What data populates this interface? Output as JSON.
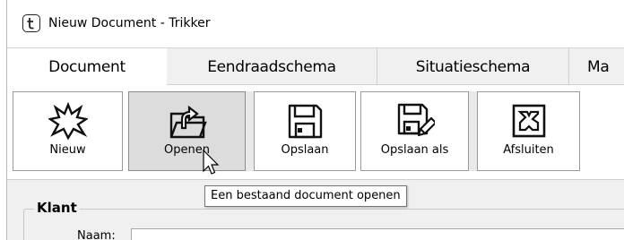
{
  "window": {
    "title": "Nieuw Document - Trikker",
    "icon": "trikker-app-icon"
  },
  "tabs": [
    {
      "label": "Document",
      "active": true
    },
    {
      "label": "Eendraadschema",
      "active": false
    },
    {
      "label": "Situatieschema",
      "active": false
    },
    {
      "label": "Ma",
      "active": false
    }
  ],
  "toolbar": {
    "buttons": [
      {
        "label": "Nieuw",
        "icon": "new-burst-icon"
      },
      {
        "label": "Openen",
        "icon": "open-folder-icon",
        "hovered": true
      },
      {
        "label": "Opslaan",
        "icon": "floppy-disk-icon"
      },
      {
        "label": "Opslaan als",
        "icon": "save-as-floppy-icon"
      },
      {
        "label": "Afsluiten",
        "icon": "close-x-icon"
      }
    ]
  },
  "tooltip": {
    "text": "Een bestaand document openen"
  },
  "form": {
    "group_title": "Klant",
    "fields": [
      {
        "label": "Naam:",
        "value": ""
      }
    ]
  },
  "colors": {
    "tabstrip_bg": "#f0f0f0",
    "hover_bg": "#dcdcdc",
    "button_border": "#9a9a9a",
    "form_bg": "#f0f0f0"
  }
}
